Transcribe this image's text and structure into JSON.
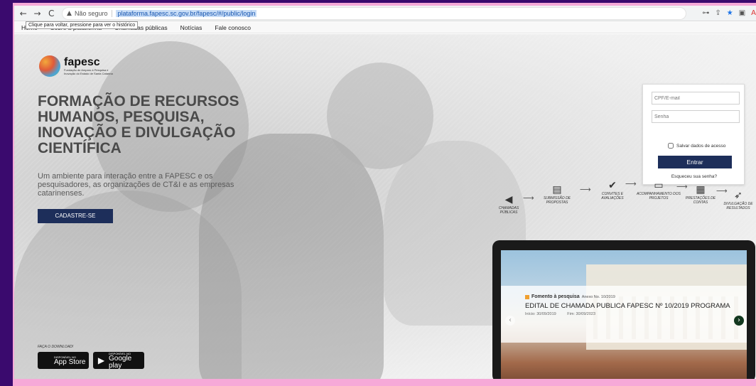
{
  "browser": {
    "back_icon": "←",
    "forward_icon": "→",
    "reload_icon": "C",
    "warning_icon": "▲",
    "not_secure": "Não seguro",
    "url": "plataforma.fapesc.sc.gov.br/fapesc/#/public/login",
    "key_icon": "⊶",
    "share_icon": "⇪",
    "star_icon": "★",
    "sidebar_icon": "▣",
    "extension_icon": "A"
  },
  "tooltip": "Clique para voltar, pressione para ver o histórico",
  "nav": {
    "items": [
      "Home",
      "Sobre a plataforma",
      "Chamadas públicas",
      "Notícias",
      "Fale conosco"
    ]
  },
  "brand": {
    "name": "fapesc",
    "subtitle": "Fundação de Amparo à Pesquisa e Inovação do Estado de Santa Catarina"
  },
  "hero": {
    "headline": "FORMAÇÃO DE RECURSOS HUMANOS, PESQUISA, INOVAÇÃO E DIVULGAÇÃO CIENTÍFICA",
    "subtext": "Um ambiente para interação entre a FAPESC e os pesquisadores, as organizações de CT&I e as empresas catarinenses.",
    "cta": "CADASTRE-SE",
    "download_label": "FAÇA O DOWNLOAD!",
    "appstore": {
      "small": "DISPONÍVEL NO",
      "big": "App Store",
      "glyph": ""
    },
    "googleplay": {
      "small": "DISPONÍVEL NO",
      "big": "Google play",
      "glyph": "▶"
    }
  },
  "login": {
    "user_placeholder": "CPF/E-mail",
    "pass_placeholder": "Senha",
    "save_label": "Salvar dados de acesso",
    "submit": "Entrar",
    "forgot": "Esqueceu sua senha?"
  },
  "flow": {
    "steps": [
      {
        "icon": "megaphone-icon",
        "glyph": "◀",
        "label": "CHAMADAS PÚBLICAS"
      },
      {
        "icon": "document-icon",
        "glyph": "▤",
        "label": "SUBMISSÃO DE PROPOSTAS"
      },
      {
        "icon": "check-circle-icon",
        "glyph": "✔",
        "label": "CONVITES E AVALIAÇÕES"
      },
      {
        "icon": "laptop-icon",
        "glyph": "▭",
        "label": "ACOMPANHAMENTO DOS PROJETOS"
      },
      {
        "icon": "calculator-icon",
        "glyph": "▦",
        "label": "PRESTAÇÕES DE CONTAS"
      },
      {
        "icon": "paper-plane-icon",
        "glyph": "➶",
        "label": "DIVULGAÇÃO DE RESULTADOS"
      }
    ],
    "arrow": "⟶"
  },
  "news": {
    "category": "Fomento à pesquisa",
    "annex": "Anexo No. 10/2019",
    "title": "EDITAL DE CHAMADA PUBLICA FAPESC Nº 10/2019 PROGRAMA",
    "start": "Início: 30/09/2019",
    "end": "Fim: 30/09/2023",
    "prev_icon": "‹",
    "next_icon": "›"
  }
}
